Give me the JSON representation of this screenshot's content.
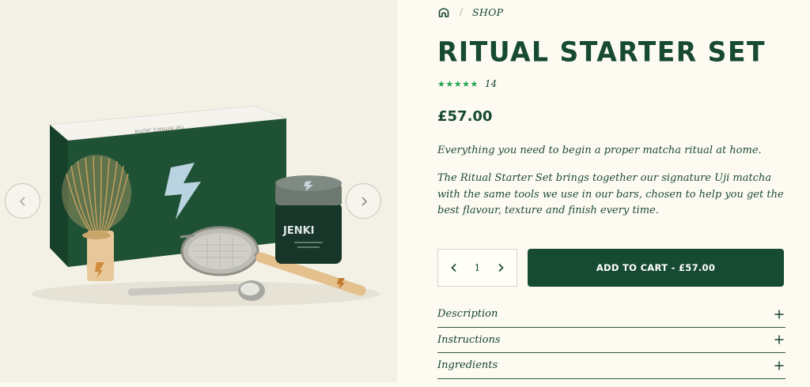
{
  "breadcrumb": {
    "home_icon": "home-icon",
    "separator": "/",
    "shop_label": "SHOP"
  },
  "product": {
    "title": "RITUAL STARTER SET",
    "stars": "★★★★★",
    "review_count": "14",
    "price": "£57.00",
    "intro": "Everything you need to begin a proper matcha ritual at home.",
    "description": "The Ritual Starter Set brings together our signature Uji matcha with the same tools we use in our bars, chosen to help you get the best flavour, texture and finish every time."
  },
  "image": {
    "box_text": "RITUAL STARTER SET",
    "tin_brand": "JENKI"
  },
  "purchase": {
    "quantity": "1",
    "add_to_cart_label": "ADD TO CART  -  £57.00"
  },
  "accordion": [
    {
      "label": "Description"
    },
    {
      "label": "Instructions"
    },
    {
      "label": "Ingredients"
    }
  ],
  "colors": {
    "brand_green": "#174a32",
    "star_green": "#1fa24f",
    "background": "#fdfbf1"
  }
}
